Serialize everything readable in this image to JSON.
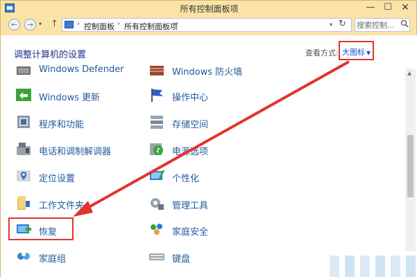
{
  "window": {
    "title": "所有控制面板项",
    "buttons": {
      "minimize": "—",
      "maximize": "☐",
      "close": "✕"
    }
  },
  "address_bar": {
    "back": "←",
    "forward": "→",
    "dropdown": "▾",
    "up": "↑",
    "crumbs": [
      "控制面板",
      "所有控制面板项"
    ],
    "separator": "›",
    "refresh": "↻"
  },
  "search": {
    "placeholder": "搜索控制...",
    "icon": "search-icon"
  },
  "content": {
    "heading": "调整计算机的设置",
    "view_by_label": "查看方式:",
    "view_by_value": "大图标"
  },
  "items": [
    {
      "label": "Windows Defender",
      "icon": "shield-icon"
    },
    {
      "label": "Windows 防火墙",
      "icon": "firewall-icon"
    },
    {
      "label": "Windows 更新",
      "icon": "update-icon"
    },
    {
      "label": "操作中心",
      "icon": "flag-icon"
    },
    {
      "label": "程序和功能",
      "icon": "programs-icon"
    },
    {
      "label": "存储空间",
      "icon": "storage-icon"
    },
    {
      "label": "电话和调制解调器",
      "icon": "phone-icon"
    },
    {
      "label": "电源选项",
      "icon": "power-icon"
    },
    {
      "label": "定位设置",
      "icon": "location-icon"
    },
    {
      "label": "个性化",
      "icon": "personalize-icon"
    },
    {
      "label": "工作文件夹",
      "icon": "folder-icon"
    },
    {
      "label": "管理工具",
      "icon": "tools-icon"
    },
    {
      "label": "恢复",
      "icon": "recovery-icon"
    },
    {
      "label": "家庭安全",
      "icon": "family-icon"
    },
    {
      "label": "家庭组",
      "icon": "homegroup-icon"
    },
    {
      "label": "键盘",
      "icon": "keyboard-icon"
    }
  ],
  "colors": {
    "accent_red": "#e0342c",
    "link_blue": "#1f5a9c",
    "title_bar": "#fbe3a8"
  }
}
